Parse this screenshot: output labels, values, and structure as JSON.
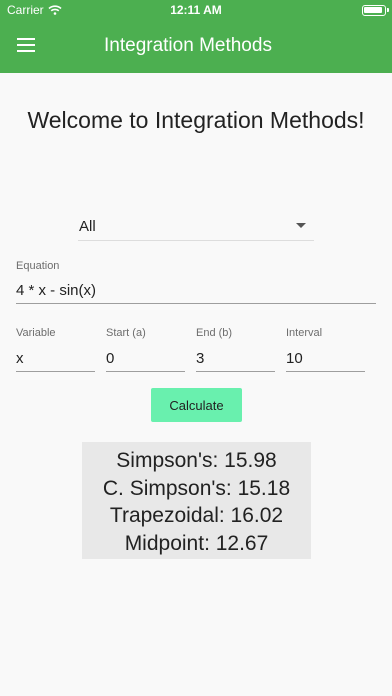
{
  "status_bar": {
    "carrier": "Carrier",
    "time": "12:11 AM"
  },
  "app_bar": {
    "title": "Integration Methods"
  },
  "welcome": "Welcome to Integration Methods!",
  "method_select": {
    "selected": "All"
  },
  "equation": {
    "label": "Equation",
    "value": "4 * x - sin(x)"
  },
  "variable": {
    "label": "Variable",
    "value": "x"
  },
  "start": {
    "label": "Start (a)",
    "value": "0"
  },
  "end": {
    "label": "End (b)",
    "value": "3"
  },
  "interval": {
    "label": "Interval",
    "value": "10"
  },
  "calculate_label": "Calculate",
  "results": {
    "simpson": "Simpson's: 15.98",
    "composite_simpson": "C. Simpson's: 15.18",
    "trapezoidal": "Trapezoidal: 16.02",
    "midpoint": "Midpoint: 12.67"
  },
  "colors": {
    "app_bar": "#4caf50",
    "button": "#69f0ae",
    "results_bg": "#e8e8e8"
  }
}
